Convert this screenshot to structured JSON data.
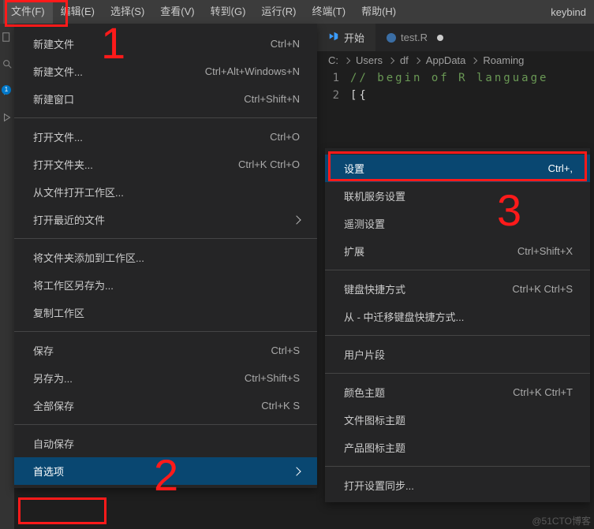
{
  "menubar": {
    "items": [
      "文件(F)",
      "编辑(E)",
      "选择(S)",
      "查看(V)",
      "转到(G)",
      "运行(R)",
      "终端(T)",
      "帮助(H)"
    ],
    "title_fragment": "keybind"
  },
  "file_menu": {
    "group1": [
      {
        "label": "新建文件",
        "shortcut": "Ctrl+N"
      },
      {
        "label": "新建文件...",
        "shortcut": "Ctrl+Alt+Windows+N"
      },
      {
        "label": "新建窗口",
        "shortcut": "Ctrl+Shift+N"
      }
    ],
    "group2": [
      {
        "label": "打开文件...",
        "shortcut": "Ctrl+O"
      },
      {
        "label": "打开文件夹...",
        "shortcut": "Ctrl+K Ctrl+O"
      },
      {
        "label": "从文件打开工作区...",
        "shortcut": ""
      },
      {
        "label": "打开最近的文件",
        "shortcut": "",
        "chevron": true
      }
    ],
    "group3": [
      {
        "label": "将文件夹添加到工作区...",
        "shortcut": ""
      },
      {
        "label": "将工作区另存为...",
        "shortcut": ""
      },
      {
        "label": "复制工作区",
        "shortcut": ""
      }
    ],
    "group4": [
      {
        "label": "保存",
        "shortcut": "Ctrl+S"
      },
      {
        "label": "另存为...",
        "shortcut": "Ctrl+Shift+S"
      },
      {
        "label": "全部保存",
        "shortcut": "Ctrl+K S"
      }
    ],
    "group5": [
      {
        "label": "自动保存",
        "shortcut": ""
      },
      {
        "label": "首选项",
        "shortcut": "",
        "chevron": true,
        "highlight": true
      }
    ]
  },
  "pref_submenu": {
    "group1": [
      {
        "label": "设置",
        "shortcut": "Ctrl+,",
        "highlight": true
      },
      {
        "label": "联机服务设置",
        "shortcut": ""
      },
      {
        "label": "遥测设置",
        "shortcut": ""
      },
      {
        "label": "扩展",
        "shortcut": "Ctrl+Shift+X"
      }
    ],
    "group2": [
      {
        "label": "键盘快捷方式",
        "shortcut": "Ctrl+K Ctrl+S"
      },
      {
        "label": "从 - 中迁移键盘快捷方式...",
        "shortcut": ""
      }
    ],
    "group3": [
      {
        "label": "用户片段",
        "shortcut": ""
      }
    ],
    "group4": [
      {
        "label": "颜色主题",
        "shortcut": "Ctrl+K Ctrl+T"
      },
      {
        "label": "文件图标主题",
        "shortcut": ""
      },
      {
        "label": "产品图标主题",
        "shortcut": ""
      }
    ],
    "group5": [
      {
        "label": "打开设置同步...",
        "shortcut": ""
      }
    ]
  },
  "editor": {
    "tabs": [
      {
        "label": "开始",
        "kind": "start"
      },
      {
        "label": "test.R",
        "kind": "r",
        "dirty": true
      }
    ],
    "breadcrumb": [
      "C:",
      "Users",
      "df",
      "AppData",
      "Roaming"
    ],
    "lines": [
      {
        "n": "1",
        "text": "// begin of R language",
        "cls": "code-green"
      },
      {
        "n": "2",
        "text": "[{",
        "cls": "code-white"
      }
    ]
  },
  "activity_badge": "1",
  "annotations": {
    "n1": "1",
    "n2": "2",
    "n3": "3"
  },
  "watermark": "@51CTO博客"
}
